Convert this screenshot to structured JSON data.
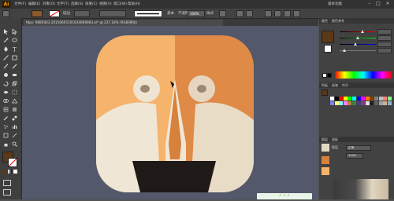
{
  "app": {
    "logo": "Ai",
    "workspace_label": "基本功能",
    "menu": [
      "文件(F)",
      "编辑(E)",
      "对象(O)",
      "文字(T)",
      "选择(S)",
      "效果(C)",
      "视图(V)",
      "窗口(W)",
      "帮助(H)"
    ]
  },
  "options_bar": {
    "stroke_label": "描边",
    "stroke_width": "",
    "stroke_style": "基本",
    "opacity_label": "不透明度",
    "opacity_value": "100%",
    "style_label": "样式"
  },
  "document": {
    "tab_title": "fdps: 9885403 20150605101634669083.ai* @ 237.18% (RGB/预览)"
  },
  "panel": {
    "color_tabs": [
      "颜色",
      "颜色参考"
    ],
    "swatch_tabs": [
      "色板",
      "画笔",
      "符号"
    ],
    "layer_tabs": [
      "图层",
      "画板"
    ],
    "layer_name": "图层",
    "color_sliders": [
      {
        "label": "R",
        "value": 0.62
      },
      {
        "label": "G",
        "value": 0.48
      },
      {
        "label": "B",
        "value": 0.4
      },
      {
        "label": "",
        "value": 0.1
      }
    ],
    "fill_color": "#5a3818",
    "mode_value": "正常",
    "opacity_value": "100%"
  },
  "colors": {
    "app_bg": "#535353",
    "canvas_bg": "#53596b",
    "icon_left": "#f6b36b",
    "icon_right": "#e08a47",
    "cream": "#efe6d6",
    "beak": "#d6813c",
    "mouth": "#1f1a17",
    "eye_ring": "#efe4d2",
    "pupil": "#9a8874"
  },
  "swatch_colors": [
    "#ffffff",
    "#000000",
    "#ff0000",
    "#ffff00",
    "#00ff00",
    "#00ffff",
    "#0000ff",
    "#ff00ff",
    "#ff8000",
    "#804000",
    "#808080",
    "#c0c0c0",
    "#ff8080",
    "#80ff80",
    "#8080ff",
    "#ffff80",
    "#80ffff",
    "#ff80ff",
    "#c08040",
    "#408040",
    "#404080",
    "#804080",
    "#e0e0e0",
    "#202020",
    "#606060",
    "#a0a0a0",
    "#d0b090",
    "#90b0d0"
  ]
}
